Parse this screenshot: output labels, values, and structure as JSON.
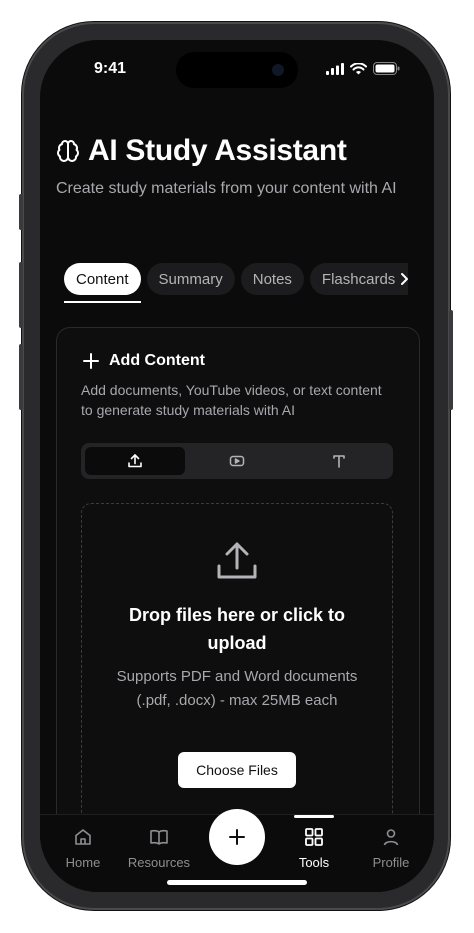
{
  "status": {
    "time": "9:41"
  },
  "header": {
    "icon": "brain-icon",
    "title": "AI Study Assistant",
    "subtitle": "Create study materials from your content with AI"
  },
  "tabs": [
    {
      "label": "Content",
      "active": true
    },
    {
      "label": "Summary",
      "active": false
    },
    {
      "label": "Notes",
      "active": false
    },
    {
      "label": "Flashcards",
      "active": false
    }
  ],
  "card": {
    "title": "Add Content",
    "description": "Add documents, YouTube videos, or text content to generate study materials with AI",
    "source_types": [
      {
        "icon": "upload-icon",
        "active": true
      },
      {
        "icon": "video-icon",
        "active": false
      },
      {
        "icon": "text-icon",
        "active": false
      }
    ]
  },
  "dropzone": {
    "icon": "upload-icon",
    "title": "Drop files here or click to upload",
    "subtitle": "Supports PDF and Word documents (.pdf, .docx) - max 25MB each",
    "button_label": "Choose Files"
  },
  "bottom_nav": {
    "items": [
      {
        "label": "Home",
        "icon": "home-icon",
        "active": false
      },
      {
        "label": "Resources",
        "icon": "book-icon",
        "active": false
      },
      {
        "label": "Tools",
        "icon": "grid-icon",
        "active": true
      },
      {
        "label": "Profile",
        "icon": "user-icon",
        "active": false
      }
    ],
    "fab_icon": "plus-icon"
  },
  "colors": {
    "background": "#0b0b0b",
    "text": "#ffffff",
    "muted": "#a8a8ad",
    "accent": "#ffffff"
  }
}
